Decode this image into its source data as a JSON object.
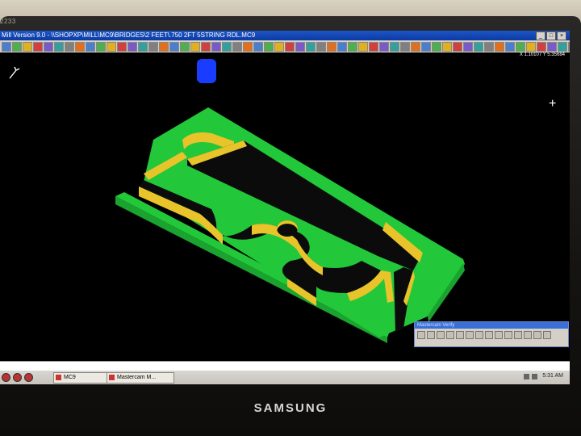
{
  "bezel": {
    "model_label": "2233",
    "brand": "SAMSUNG"
  },
  "window": {
    "title": "Mill Version 9.0 - \\\\SHOPXP\\MILL\\MC9\\BRIDGES\\2 FEET\\.750 2FT 5STRING RDL.MC9"
  },
  "viewport": {
    "coords": "X 1.10107  Y 5.35684",
    "background": "#000000",
    "part_colors": {
      "top": "#22c83a",
      "walls": "#e8c42a",
      "tool": "#1a3cff"
    }
  },
  "mini_window": {
    "title": "Mastercam Verify"
  },
  "taskbar": {
    "tasks": [
      {
        "label": "MC9"
      },
      {
        "label": "Mastercam M..."
      }
    ],
    "clock": "5:31 AM"
  }
}
